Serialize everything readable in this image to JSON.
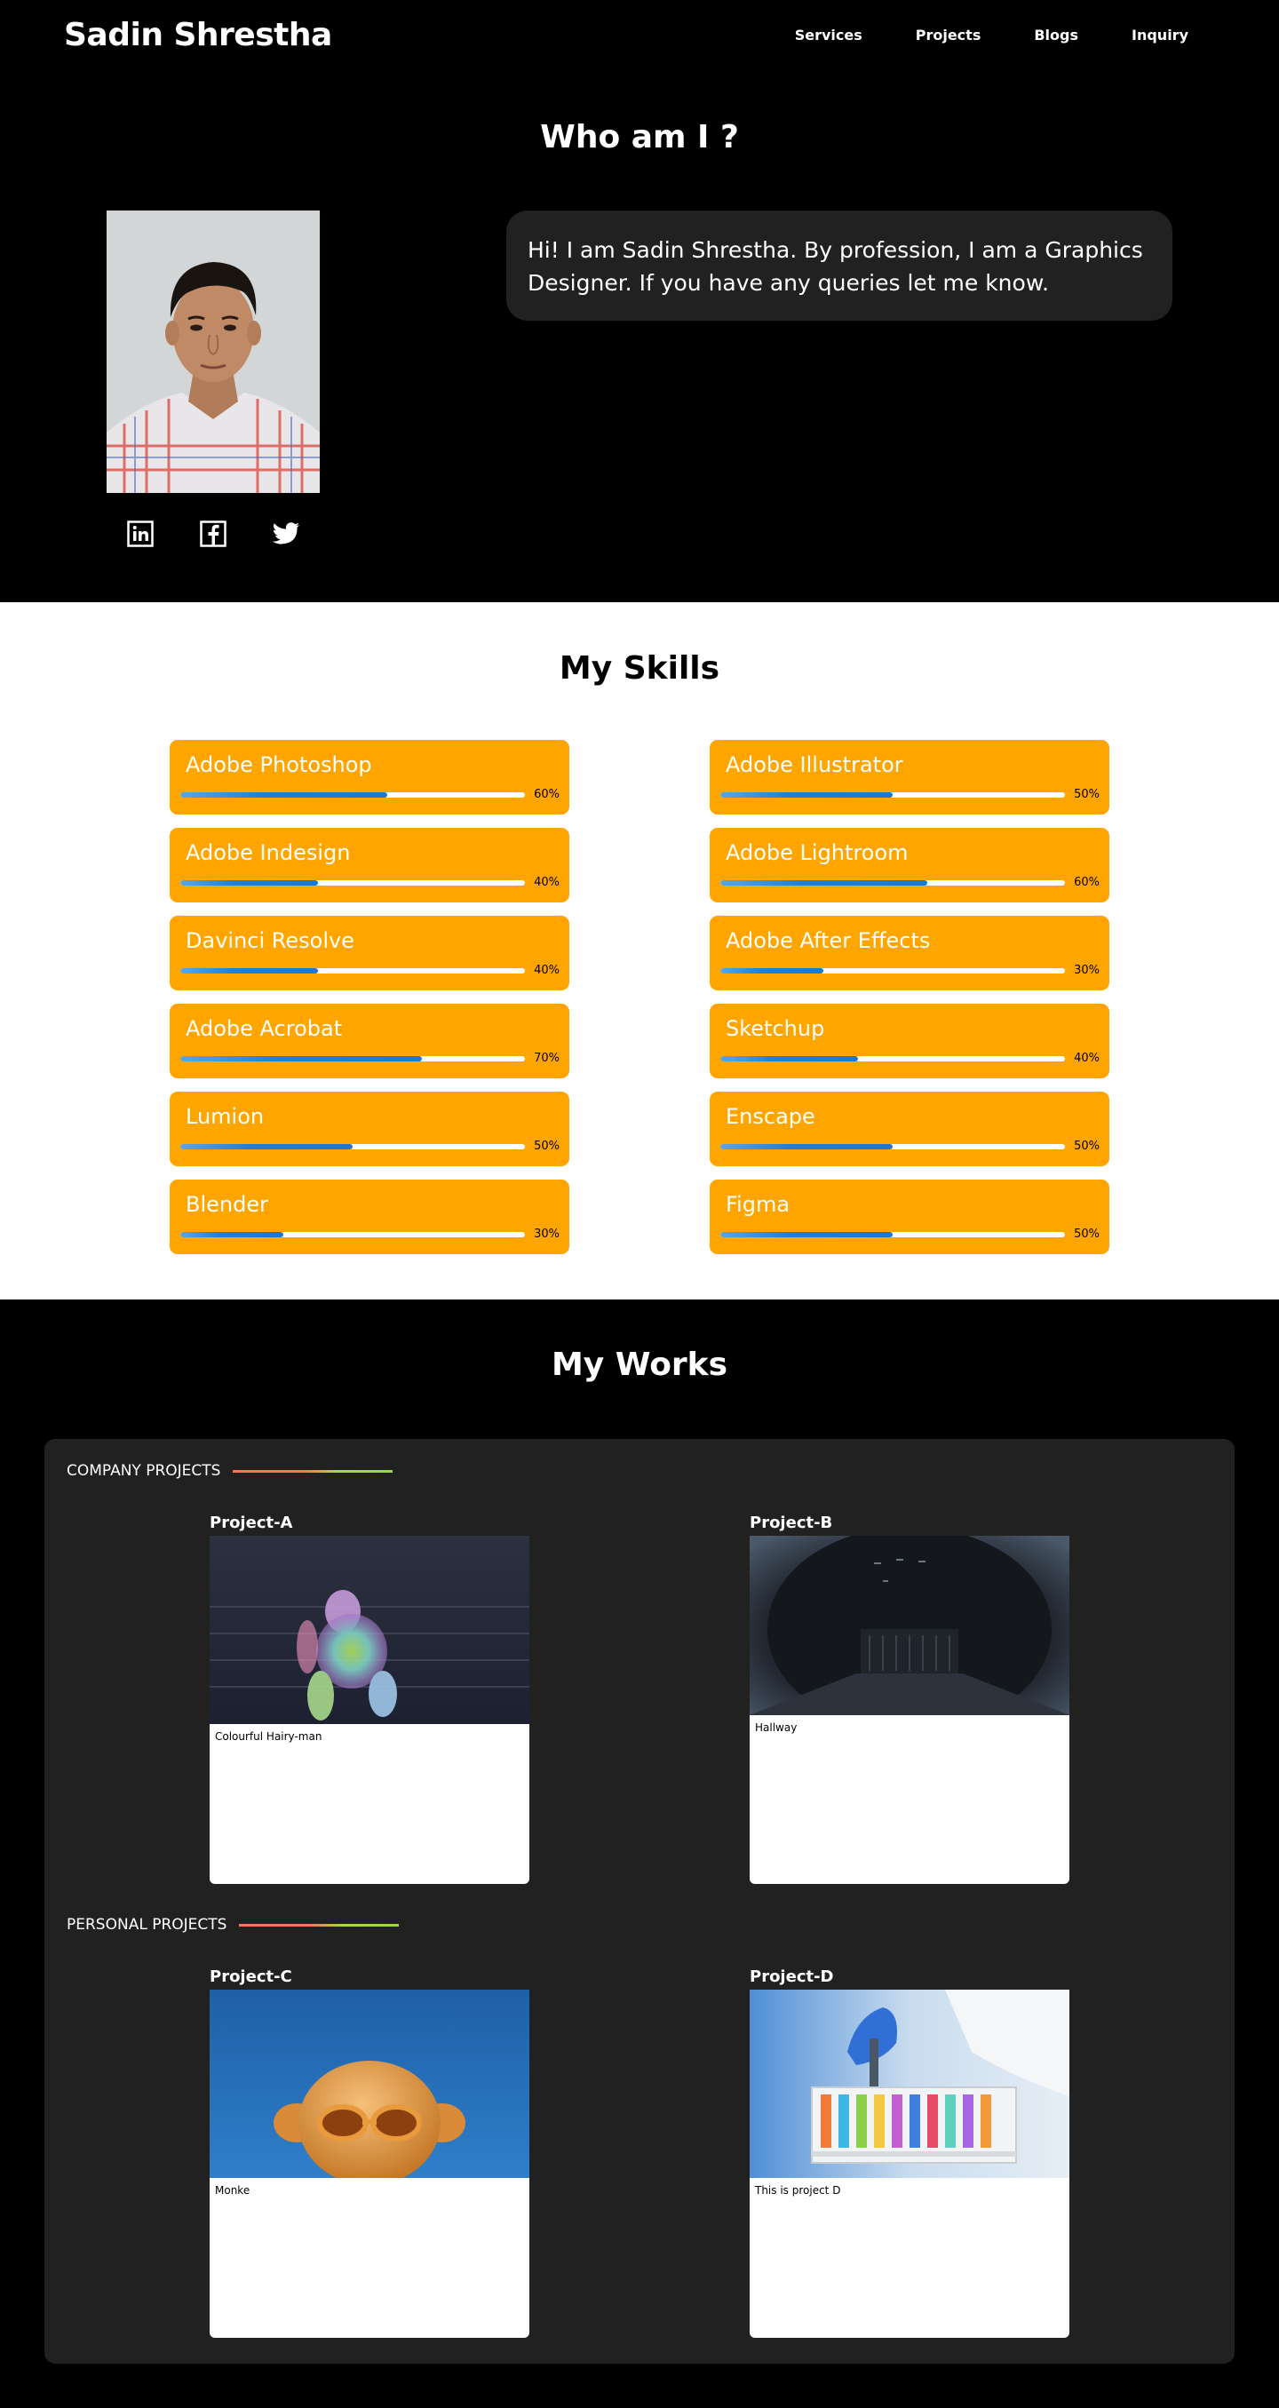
{
  "header": {
    "brand": "Sadin Shrestha",
    "nav": [
      "Services",
      "Projects",
      "Blogs",
      "Inquiry"
    ]
  },
  "about": {
    "title": "Who am I ?",
    "bio": "Hi! I am Sadin Shrestha. By profession, I am a Graphics Designer. If you have any queries let me know.",
    "socials": [
      "linkedin-icon",
      "facebook-icon",
      "twitter-icon"
    ]
  },
  "skills": {
    "title": "My Skills",
    "left": [
      {
        "name": "Adobe Photoshop",
        "pct_label": "60%",
        "level": 0.6
      },
      {
        "name": "Adobe Indesign",
        "pct_label": "40%",
        "level": 0.4
      },
      {
        "name": "Davinci Resolve",
        "pct_label": "40%",
        "level": 0.4
      },
      {
        "name": "Adobe Acrobat",
        "pct_label": "70%",
        "level": 0.7
      },
      {
        "name": "Lumion",
        "pct_label": "50%",
        "level": 0.5
      },
      {
        "name": "Blender",
        "pct_label": "30%",
        "level": 0.3
      }
    ],
    "right": [
      {
        "name": "Adobe Illustrator",
        "pct_label": "50%",
        "level": 0.5
      },
      {
        "name": "Adobe Lightroom",
        "pct_label": "60%",
        "level": 0.6
      },
      {
        "name": "Adobe After Effects",
        "pct_label": "30%",
        "level": 0.3
      },
      {
        "name": "Sketchup",
        "pct_label": "40%",
        "level": 0.4
      },
      {
        "name": "Enscape",
        "pct_label": "50%",
        "level": 0.5
      },
      {
        "name": "Figma",
        "pct_label": "50%",
        "level": 0.5
      }
    ]
  },
  "works": {
    "title": "My Works",
    "company_heading": "COMPANY PROJECTS",
    "personal_heading": "PERSONAL PROJECTS",
    "projects": [
      {
        "title": "Project-A",
        "caption": "Colourful Hairy-man"
      },
      {
        "title": "Project-B",
        "caption": "Hallway"
      },
      {
        "title": "Project-C",
        "caption": "Monke"
      },
      {
        "title": "Project-D",
        "caption": "This is project D"
      }
    ]
  },
  "colors": {
    "accent_orange": "#ffa500",
    "bar_blue": "#1e7fd6",
    "panel": "#212121"
  }
}
